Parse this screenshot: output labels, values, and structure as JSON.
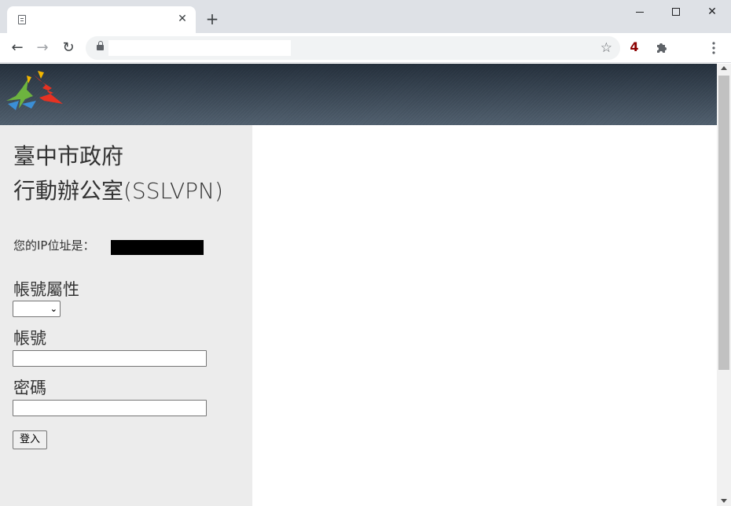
{
  "browser": {
    "tab": {
      "title": "",
      "close_glyph": "✕"
    },
    "new_tab_glyph": "+",
    "window_controls": {
      "minimize": "minimize-icon",
      "maximize": "maximize-icon",
      "close": "✕"
    },
    "nav": {
      "back": "←",
      "forward": "→",
      "reload": "↻"
    },
    "address_bar": {
      "url": "",
      "bookmark_glyph": "☆"
    },
    "extensions": {
      "badge_count": "4",
      "badge_color": "#8b0000"
    }
  },
  "page": {
    "banner": {
      "logo": "taichung-city-logo"
    },
    "title_line1": "臺中市政府",
    "title_line2": "行動辦公室(SSLVPN)",
    "ip_label": "您的IP位址是：",
    "account_type_label": "帳號屬性",
    "account_type_selected": "",
    "account_label": "帳號",
    "account_value": "",
    "password_label": "密碼",
    "password_value": "",
    "login_button": "登入"
  },
  "colors": {
    "panel_bg": "#ececec",
    "banner_bg": "#6d7c8a",
    "text": "#333333"
  }
}
